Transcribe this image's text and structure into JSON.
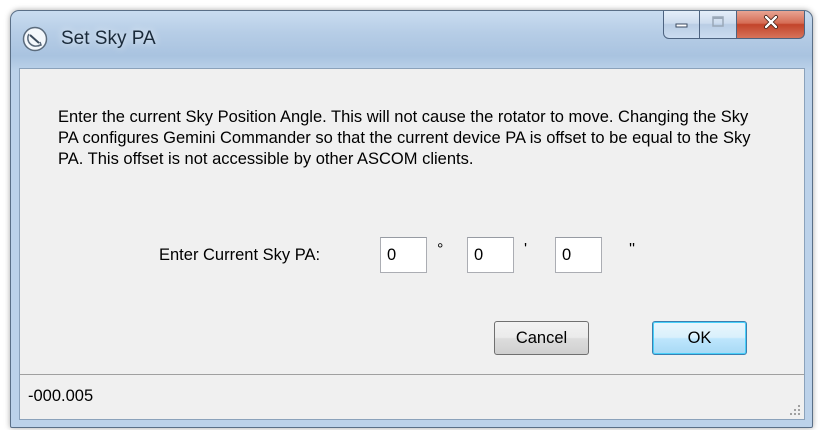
{
  "window": {
    "title": "Set Sky PA",
    "app_icon": "rotator-icon",
    "caption_buttons": [
      "minimize-icon",
      "maximize-icon",
      "close-icon"
    ]
  },
  "dialog": {
    "description": "Enter the current Sky Position Angle. This will not cause the rotator to move.  Changing the Sky PA configures Gemini Commander so that the current device PA is offset to be equal to the Sky PA. This offset is not accessible by other ASCOM clients.",
    "pa_label": "Enter Current Sky PA:",
    "degrees_value": "0",
    "degrees_unit": "°",
    "minutes_value": "0",
    "minutes_unit": "'",
    "seconds_value": "0",
    "seconds_unit": "''",
    "cancel_label": "Cancel",
    "ok_label": "OK"
  },
  "status": {
    "text": "-000.005"
  },
  "colors": {
    "title_bar": "#b6cde6",
    "dialog_background": "#f0f0f0",
    "close_button": "#c2442a",
    "default_button_border": "#3c7fb1"
  }
}
